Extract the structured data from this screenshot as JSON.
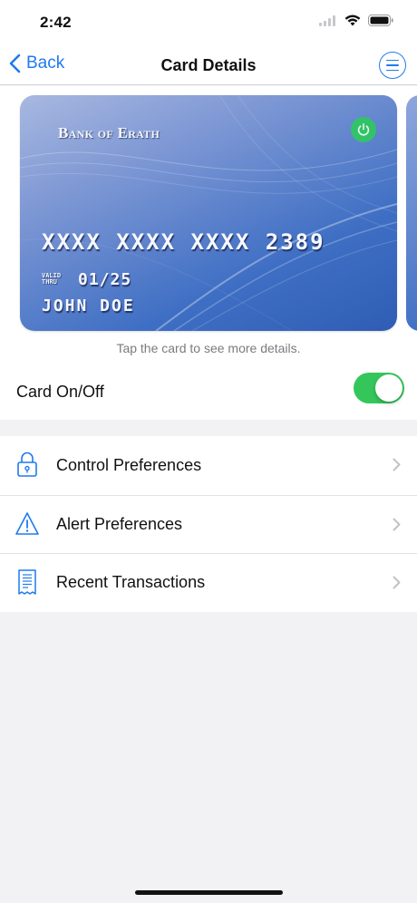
{
  "status_bar": {
    "time": "2:42"
  },
  "nav": {
    "back_label": "Back",
    "title": "Card Details"
  },
  "card": {
    "bank_name": "Bank of Erath",
    "number": "XXXX XXXX XXXX 2389",
    "valid_thru_label": "VALID THRU",
    "expiry": "01/25",
    "holder": "JOHN DOE",
    "hint": "Tap the card to see more details."
  },
  "toggle": {
    "label": "Card On/Off",
    "on": true
  },
  "menu": {
    "items": [
      {
        "label": "Control Preferences",
        "icon": "lock-icon"
      },
      {
        "label": "Alert Preferences",
        "icon": "warning-icon"
      },
      {
        "label": "Recent Transactions",
        "icon": "receipt-icon"
      }
    ]
  },
  "colors": {
    "accent": "#1f7af0",
    "toggle_on": "#35c65b",
    "power": "#33c26a"
  }
}
